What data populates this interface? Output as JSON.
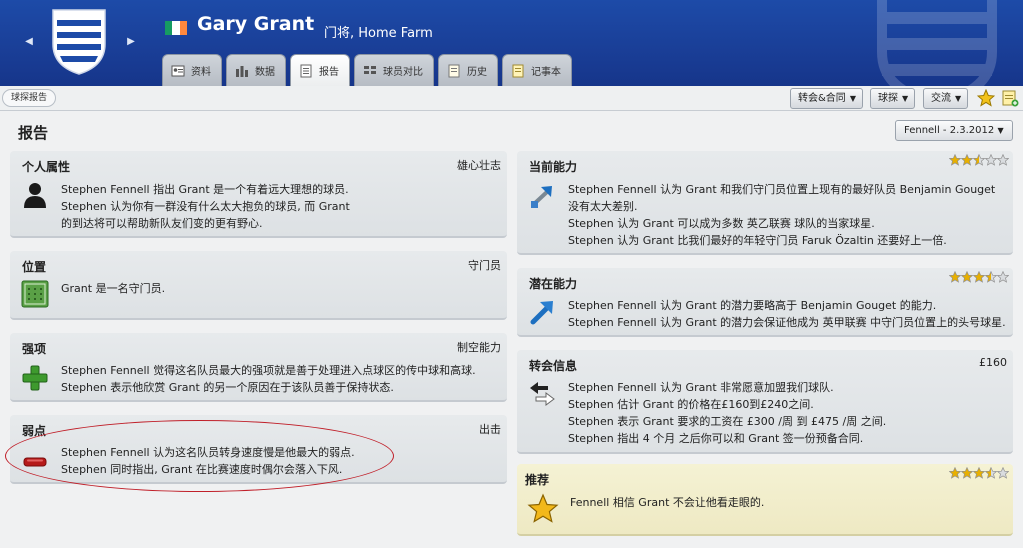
{
  "header": {
    "player_name": "Gary Grant",
    "player_sub": "门将, Home Farm",
    "flag_colors": [
      "#169b62",
      "#ffffff",
      "#ff883e"
    ],
    "tabs": [
      {
        "label": "资料",
        "icon": "profile-icon",
        "active": false
      },
      {
        "label": "数据",
        "icon": "stats-icon",
        "active": false
      },
      {
        "label": "报告",
        "icon": "report-icon",
        "active": true
      },
      {
        "label": "球员对比",
        "icon": "compare-icon",
        "active": false
      },
      {
        "label": "历史",
        "icon": "history-icon",
        "active": false
      },
      {
        "label": "记事本",
        "icon": "notes-icon",
        "active": false
      }
    ]
  },
  "toolbar": {
    "breadcrumb": "球探报告",
    "transfer_btn": "转会&合同",
    "scout_btn": "球探",
    "interact_btn": "交流"
  },
  "main": {
    "title": "报告",
    "scout_select": "Fennell - 2.3.2012"
  },
  "left_panels": [
    {
      "title": "个人属性",
      "value": "雄心壮志",
      "icon": "person-silhouette-icon",
      "lines": [
        "Stephen Fennell 指出 Grant 是一个有着远大理想的球员.",
        "Stephen 认为你有一群没有什么太大抱负的球员, 而 Grant",
        "的到达将可以帮助新队友们变的更有野心."
      ]
    },
    {
      "title": "位置",
      "value": "守门员",
      "icon": "pitch-position-icon",
      "lines": [
        "Grant 是一名守门员."
      ]
    },
    {
      "title": "强项",
      "value": "制空能力",
      "icon": "plus-icon",
      "lines": [
        "Stephen Fennell 觉得这名队员最大的强项就是善于处理进入点球区的传中球和高球.",
        "Stephen 表示他欣赏 Grant 的另一个原因在于该队员善于保持状态."
      ]
    },
    {
      "title": "弱点",
      "value": "出击",
      "icon": "minus-icon",
      "lines": [
        "Stephen Fennell 认为这名队员转身速度慢是他最大的弱点.",
        "Stephen 同时指出, Grant 在比赛速度时偶尔会落入下风."
      ]
    }
  ],
  "right_panels": [
    {
      "title": "当前能力",
      "stars": 2.5,
      "icon": "current-ability-arrow-icon",
      "lines": [
        "Stephen Fennell 认为 Grant 和我们守门员位置上现有的最好队员 Benjamin Gouget",
        "没有太大差别.",
        "Stephen 认为 Grant 可以成为多数 英乙联赛 球队的当家球星.",
        "Stephen 认为 Grant 比我们最好的年轻守门员 Faruk Özaltin 还要好上一倍."
      ]
    },
    {
      "title": "潜在能力",
      "stars": 3.5,
      "icon": "potential-arrow-icon",
      "lines": [
        "Stephen Fennell 认为 Grant 的潜力要略高于 Benjamin Gouget 的能力.",
        "Stephen Fennell 认为 Grant 的潜力会保证他成为 英甲联赛 中守门员位置上的头号球星."
      ]
    },
    {
      "title": "转会信息",
      "value": "£160",
      "icon": "transfer-arrows-icon",
      "lines": [
        "Stephen Fennell 认为 Grant 非常愿意加盟我们球队.",
        "Stephen 估计 Grant 的价格在£160到£240之间.",
        "Stephen 表示 Grant 要求的工资在 £300 /周 到 £475 /周 之间.",
        "Stephen 指出 4 个月 之后你可以和 Grant 签一份预备合同."
      ]
    },
    {
      "title": "推荐",
      "stars": 3.5,
      "icon": "recommend-star-icon",
      "lines": [
        "Fennell 相信 Grant 不会让他看走眼的."
      ]
    }
  ],
  "colors": {
    "header_blue": "#1a3f98",
    "star_gold": "#e8b000",
    "annotation_red": "#c0202a"
  }
}
